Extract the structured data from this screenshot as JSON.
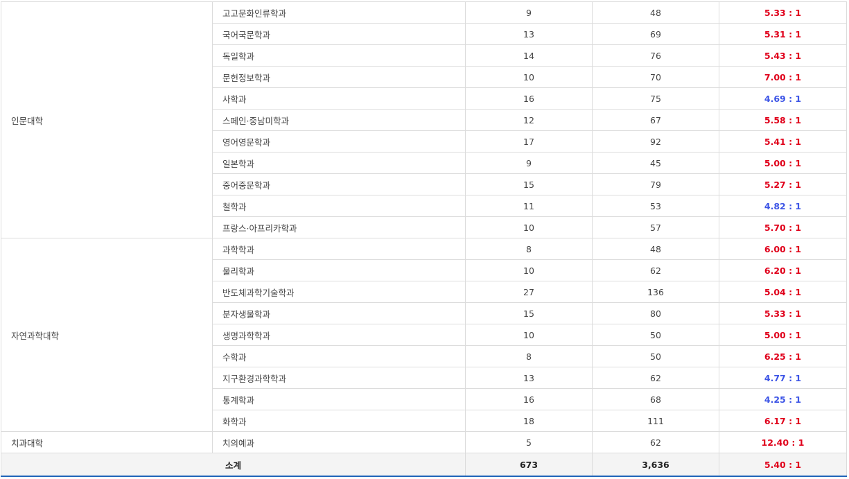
{
  "table": {
    "groups": [
      {
        "college": "인문대학",
        "rows": [
          {
            "dept": "고고문화인류학과",
            "quota": "9",
            "applicants": "48",
            "ratio": "5.33 : 1",
            "ratio_color": "red"
          },
          {
            "dept": "국어국문학과",
            "quota": "13",
            "applicants": "69",
            "ratio": "5.31 : 1",
            "ratio_color": "red"
          },
          {
            "dept": "독일학과",
            "quota": "14",
            "applicants": "76",
            "ratio": "5.43 : 1",
            "ratio_color": "red"
          },
          {
            "dept": "문헌정보학과",
            "quota": "10",
            "applicants": "70",
            "ratio": "7.00 : 1",
            "ratio_color": "red"
          },
          {
            "dept": "사학과",
            "quota": "16",
            "applicants": "75",
            "ratio": "4.69 : 1",
            "ratio_color": "blue"
          },
          {
            "dept": "스페인·중남미학과",
            "quota": "12",
            "applicants": "67",
            "ratio": "5.58 : 1",
            "ratio_color": "red"
          },
          {
            "dept": "영어영문학과",
            "quota": "17",
            "applicants": "92",
            "ratio": "5.41 : 1",
            "ratio_color": "red"
          },
          {
            "dept": "일본학과",
            "quota": "9",
            "applicants": "45",
            "ratio": "5.00 : 1",
            "ratio_color": "red"
          },
          {
            "dept": "중어중문학과",
            "quota": "15",
            "applicants": "79",
            "ratio": "5.27 : 1",
            "ratio_color": "red"
          },
          {
            "dept": "철학과",
            "quota": "11",
            "applicants": "53",
            "ratio": "4.82 : 1",
            "ratio_color": "blue"
          },
          {
            "dept": "프랑스·아프리카학과",
            "quota": "10",
            "applicants": "57",
            "ratio": "5.70 : 1",
            "ratio_color": "red"
          }
        ]
      },
      {
        "college": "자연과학대학",
        "rows": [
          {
            "dept": "과학학과",
            "quota": "8",
            "applicants": "48",
            "ratio": "6.00 : 1",
            "ratio_color": "red"
          },
          {
            "dept": "물리학과",
            "quota": "10",
            "applicants": "62",
            "ratio": "6.20 : 1",
            "ratio_color": "red"
          },
          {
            "dept": "반도체과학기술학과",
            "quota": "27",
            "applicants": "136",
            "ratio": "5.04 : 1",
            "ratio_color": "red"
          },
          {
            "dept": "분자생물학과",
            "quota": "15",
            "applicants": "80",
            "ratio": "5.33 : 1",
            "ratio_color": "red"
          },
          {
            "dept": "생명과학학과",
            "quota": "10",
            "applicants": "50",
            "ratio": "5.00 : 1",
            "ratio_color": "red"
          },
          {
            "dept": "수학과",
            "quota": "8",
            "applicants": "50",
            "ratio": "6.25 : 1",
            "ratio_color": "red"
          },
          {
            "dept": "지구환경과학학과",
            "quota": "13",
            "applicants": "62",
            "ratio": "4.77 : 1",
            "ratio_color": "blue"
          },
          {
            "dept": "통계학과",
            "quota": "16",
            "applicants": "68",
            "ratio": "4.25 : 1",
            "ratio_color": "blue"
          },
          {
            "dept": "화학과",
            "quota": "18",
            "applicants": "111",
            "ratio": "6.17 : 1",
            "ratio_color": "red"
          }
        ]
      },
      {
        "college": "치과대학",
        "rows": [
          {
            "dept": "치의예과",
            "quota": "5",
            "applicants": "62",
            "ratio": "12.40 : 1",
            "ratio_color": "red"
          }
        ]
      }
    ],
    "total": {
      "label": "소계",
      "quota": "673",
      "applicants": "3,636",
      "ratio": "5.40 : 1"
    }
  },
  "colors": {
    "ratio_high": "#e0001b",
    "ratio_low": "#3d55e6",
    "total_border": "#1f64b8"
  }
}
